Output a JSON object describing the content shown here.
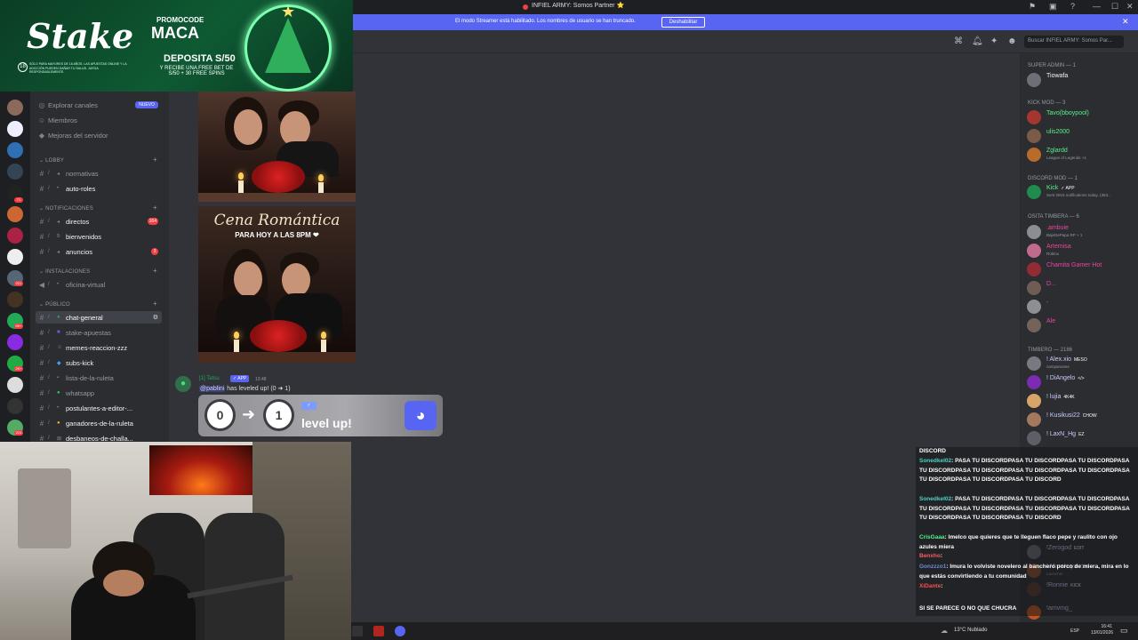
{
  "window": {
    "title": "INFIEL ARMY: Somos Partner ⭐"
  },
  "banner": {
    "text": "El modo Streamer está habilitado. Los nombres de usuario se han truncado.",
    "button": "Deshabilitar",
    "close": "✕"
  },
  "header": {
    "search_placeholder": "Buscar INFIEL ARMY: Somos Par..."
  },
  "ad": {
    "brand": "Stake",
    "tagline": "PROMOCODE",
    "code": "MACA",
    "deposit": "DEPOSITA S/50",
    "sub": "Y RECIBE UNA FREE BET DE S/50 + 30 FREE SPINS",
    "age": "18",
    "fine": "SÓLO PARA MAYORES DE 18 AÑOS. LAS APUESTAS ONLINE Y LA ADICCIÓN PUEDEN DAÑAR TU SALUD. JUEGA RESPONSABLEMENTE."
  },
  "channels": {
    "top": [
      {
        "label": "Explorar canales",
        "badge": "NUEVO"
      },
      {
        "label": "Miembros"
      },
      {
        "label": "Mejoras del servidor"
      }
    ],
    "categories": [
      {
        "name": "LOBBY",
        "items": [
          {
            "label": "normativas",
            "bright": false
          },
          {
            "label": "auto-roles",
            "bright": true
          }
        ]
      },
      {
        "name": "NOTIFICACIONES",
        "items": [
          {
            "label": "directos",
            "bright": true,
            "badge": "164"
          },
          {
            "label": "bienvenidos",
            "bright": true
          },
          {
            "label": "anuncios",
            "bright": true,
            "badge": "3"
          }
        ]
      },
      {
        "name": "INSTALACIONES",
        "items": [
          {
            "label": "oficina-virtual",
            "bright": false
          }
        ]
      },
      {
        "name": "PÚBLICO",
        "items": [
          {
            "label": "chat-general",
            "bright": true,
            "selected": true
          },
          {
            "label": "stake-apuestas",
            "bright": false
          },
          {
            "label": "memes-reaccion-zzz",
            "bright": true
          },
          {
            "label": "subs-kick",
            "bright": true
          },
          {
            "label": "lista-de-la-ruleta",
            "bright": false
          },
          {
            "label": "whatsapp",
            "bright": false
          },
          {
            "label": "postulantes-a-editor-...",
            "bright": true
          },
          {
            "label": "ganadores-de-la-ruleta",
            "bright": true
          },
          {
            "label": "desbaneos-de-challa...",
            "bright": true
          }
        ]
      }
    ],
    "server_badges": [
      "71",
      "221",
      "9K+",
      "2K+",
      "224"
    ]
  },
  "messages": {
    "image_title": "Cena Romántica",
    "image_sub": "PARA HOY A LAS 8PM ❤",
    "bot": {
      "name": "[1] Tatsu",
      "tag": "✓ APP",
      "time": "13:48",
      "mention": "@pablini",
      "text": " has leveled up! (0 ➜ 1)"
    },
    "levelup": {
      "from": "0",
      "to": "1",
      "arrow": "➜",
      "text": "level up!"
    }
  },
  "members": {
    "groups": [
      {
        "title": "SUPER ADMIN — 1",
        "members": [
          {
            "name": "Tiowafa",
            "color": "#f2f3f5",
            "avatar": "#6d6f78"
          }
        ]
      },
      {
        "title": "KICK MOD — 3",
        "members": [
          {
            "name": "Tavo(bboypool)",
            "color": "#57f287",
            "avatar": "#a3362f"
          },
          {
            "name": "ulis2000",
            "color": "#57f287",
            "avatar": "#7b5a48"
          },
          {
            "name": "Zglardd",
            "color": "#57f287",
            "avatar": "#b86b2b",
            "sub": "League of Legends +1"
          }
        ]
      },
      {
        "title": "DISCORD MOD — 1",
        "members": [
          {
            "name": "Kick",
            "color": "#57f287",
            "tag": "✓ APP",
            "avatar": "#1f8b4c",
            "sub": "Sent 2915 notifications today. (353..."
          }
        ]
      },
      {
        "title": "OSITA TIMBERA — 6",
        "members": [
          {
            "name": ".ambuie",
            "color": "#eb459e",
            "avatar": "#8a8d94",
            "sub": "BajeDePapa RP + 1"
          },
          {
            "name": "Artemisa",
            "color": "#eb459e",
            "avatar": "#c06a8f",
            "sub": "Roblox"
          },
          {
            "name": "Chamita Gamer Hot",
            "color": "#eb459e",
            "avatar": "#932b34"
          },
          {
            "name": "D...",
            "color": "#eb459e",
            "avatar": "#6f5d55"
          },
          {
            "name": "-",
            "color": "#eb459e",
            "avatar": "#8d8f95"
          },
          {
            "name": "Ale",
            "color": "#eb459e",
            "avatar": "#75635a"
          }
        ]
      },
      {
        "title": "TIMBERO — 2186",
        "members": [
          {
            "name": "! Alex.xio",
            "color": "#c9cdfb",
            "tag": "MESO",
            "avatar": "#777a80",
            "sub": "campanones"
          },
          {
            "name": "! DiAngelo",
            "color": "#c9cdfb",
            "tag": "</>",
            "avatar": "#7c2bb2"
          },
          {
            "name": "! lujia",
            "color": "#c9cdfb",
            "tag": "4K4K",
            "avatar": "#d9a46a"
          },
          {
            "name": "! Kusikusi22",
            "color": "#c9cdfb",
            "tag": "CHOW",
            "avatar": "#a2785e"
          },
          {
            "name": "! LaxN_Hg",
            "color": "#c9cdfb",
            "tag": "EZ",
            "avatar": "#5d5f66"
          },
          {
            "name": "!Zerogod",
            "color": "#c9cdfb",
            "tag": "EDIT",
            "avatar": "#6b6e75"
          },
          {
            "name": "! Marakuya",
            "color": "#c9cdfb",
            "tag": "ウイ",
            "avatar": "#8e4f2e",
            "sub": "Launcher"
          },
          {
            "name": "!Ronnie",
            "color": "#c9cdfb",
            "tag": "KICK",
            "avatar": "#5a3a30"
          },
          {
            "name": "!amvmg_",
            "color": "#c9cdfb",
            "avatar": "#c2551f"
          }
        ]
      }
    ]
  },
  "chat_overlay": {
    "lines": [
      {
        "user": "",
        "text": "DISCORD"
      },
      {
        "user": "Sonedkel02",
        "text": ": PASA TU DISCORDPASA TU DISCORDPASA TU DISCORDPASA TU DISCORDPASA TU DISCORDPASA TU DISCORDPASA TU DISCORDPASA TU DISCORDPASA TU DISCORDPASA TU DISCORD"
      },
      {
        "user": "Sonedkel02",
        "text": ": PASA TU DISCORDPASA TU DISCORDPASA TU DISCORDPASA TU DISCORDPASA TU DISCORDPASA TU DISCORDPASA TU DISCORDPASA TU DISCORDPASA TU DISCORDPASA TU DISCORD"
      },
      {
        "user": "CrisGaaa",
        "text": ": lmelco que quieres que te lleguen flaco pepe y raulito con ojo azules miera"
      },
      {
        "user": "Benxho",
        "text": ":"
      },
      {
        "user": "Gonzzzo1",
        "text": ": lmura lo volviste novelero al banchero porco de miera, mira en lo que estás convirtiendo a tu comunidad"
      },
      {
        "user": "XiDante",
        "text": ":"
      },
      {
        "user": "",
        "text": "SI SE PARECE O NO QUE CHUCRA"
      }
    ]
  },
  "taskbar": {
    "weather": "13°C  Nublado",
    "lang": "ESP",
    "time": "16:41",
    "date": "13/01/2026"
  }
}
